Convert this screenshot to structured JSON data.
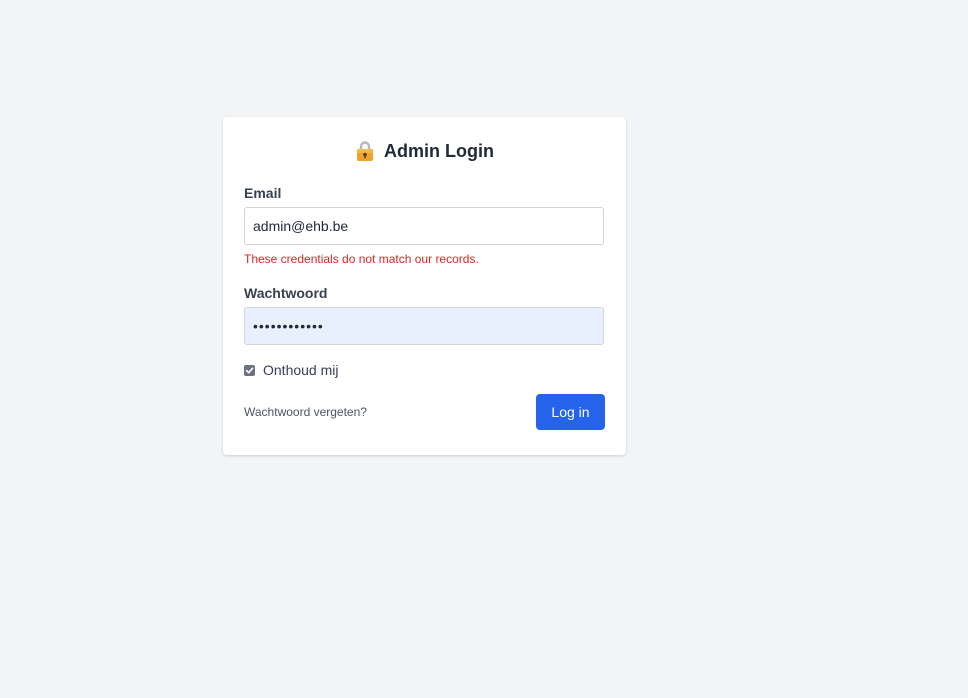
{
  "login": {
    "title": "Admin Login",
    "icon": "lock-icon",
    "email": {
      "label": "Email",
      "value": "admin@ehb.be",
      "error": "These credentials do not match our records."
    },
    "password": {
      "label": "Wachtwoord",
      "value": "••••••••••••"
    },
    "remember": {
      "label": "Onthoud mij",
      "checked": true
    },
    "forgot_link": "Wachtwoord vergeten?",
    "submit_label": "Log in"
  },
  "colors": {
    "background": "#f3f4f6",
    "card": "#ffffff",
    "primary": "#2563eb",
    "error": "#dc2626",
    "autofill": "#e8f0fe"
  }
}
